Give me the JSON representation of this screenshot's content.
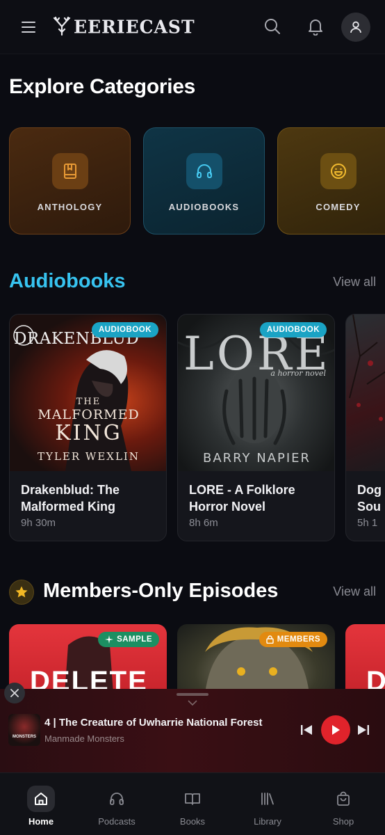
{
  "header": {
    "logo_text": "EERIECAST",
    "icons": [
      "menu-icon",
      "search-icon",
      "bell-icon",
      "user-icon"
    ]
  },
  "explore": {
    "title": "Explore Categories",
    "categories": [
      {
        "label": "ANTHOLOGY",
        "icon": "book-icon",
        "color": "#d98a2b"
      },
      {
        "label": "AUDIOBOOKS",
        "icon": "headphones-icon",
        "color": "#3fc2e8"
      },
      {
        "label": "COMEDY",
        "icon": "smile-icon",
        "color": "#f0b62a"
      }
    ]
  },
  "audiobooks": {
    "title": "Audiobooks",
    "title_color": "#37c3ef",
    "view_all": "View all",
    "items": [
      {
        "badge": "AUDIOBOOK",
        "cover_brand": "DRAKENBLUD",
        "cover_title_1": "THE",
        "cover_title_2": "MALFORMED",
        "cover_title_3": "KING",
        "cover_author": "TYLER WEXLIN",
        "title": "Drakenblud: The Malformed King",
        "duration": "9h 30m"
      },
      {
        "badge": "AUDIOBOOK",
        "cover_title": "LORE",
        "cover_subtitle": "a horror novel",
        "cover_author": "BARRY NAPIER",
        "title": "LORE - A Folklore Horror Novel",
        "duration": "8h 6m"
      },
      {
        "title_partial_1": "Dog",
        "title_partial_2": "Sou",
        "duration_partial": "5h 1"
      }
    ]
  },
  "members": {
    "title": "Members-Only Episodes",
    "view_all": "View all",
    "items": [
      {
        "badge": "SAMPLE",
        "cover_text": "DELETE"
      },
      {
        "badge": "MEMBERS"
      },
      {
        "cover_text": "D"
      }
    ]
  },
  "player": {
    "title": "4 | The Creature of Uwharrie National Forest",
    "subtitle": "Manmade Monsters",
    "thumb_text": "MONSTERS"
  },
  "nav": {
    "items": [
      {
        "label": "Home",
        "icon": "home-icon",
        "active": true
      },
      {
        "label": "Podcasts",
        "icon": "headphones-icon",
        "active": false
      },
      {
        "label": "Books",
        "icon": "open-book-icon",
        "active": false
      },
      {
        "label": "Library",
        "icon": "library-icon",
        "active": false
      },
      {
        "label": "Shop",
        "icon": "shopping-bag-icon",
        "active": false
      }
    ]
  }
}
